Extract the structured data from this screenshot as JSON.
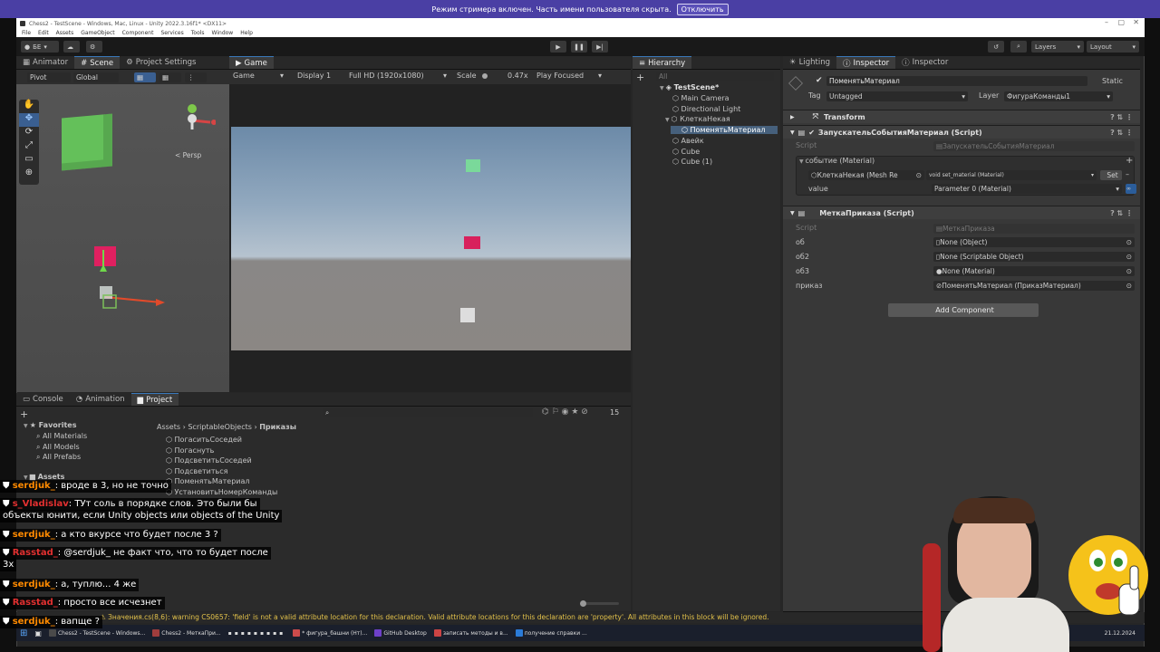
{
  "streamer_banner": {
    "text": "Режим стримера включен. Часть имени пользователя скрыта.",
    "button": "Отключить"
  },
  "window": {
    "title": "Chess2 - TestScene - Windows, Mac, Linux - Unity 2022.3.16f1* <DX11>"
  },
  "menu": [
    "File",
    "Edit",
    "Assets",
    "GameObject",
    "Component",
    "Services",
    "Tools",
    "Window",
    "Help"
  ],
  "toolbar": {
    "account": "БЕ",
    "layers": "Layers",
    "layout": "Layout"
  },
  "scene_panel": {
    "tabs": [
      "Animator",
      "Scene",
      "Project Settings"
    ],
    "pivot": "Pivot",
    "global": "Global",
    "persp": "< Persp"
  },
  "game_panel": {
    "tab": "Game",
    "mode": "Game",
    "display": "Display 1",
    "resolution": "Full HD (1920x1080)",
    "scale_label": "Scale",
    "scale_value": "0.47x",
    "play_focused": "Play Focused"
  },
  "hierarchy": {
    "tab": "Hierarchy",
    "search": "All",
    "items": [
      {
        "label": "TestScene*",
        "indent": 0,
        "type": "scene"
      },
      {
        "label": "Main Camera",
        "indent": 1,
        "type": "object"
      },
      {
        "label": "Directional Light",
        "indent": 1,
        "type": "object"
      },
      {
        "label": "КлеткаНекая",
        "indent": 1,
        "type": "object"
      },
      {
        "label": "ПоменятьМатериал",
        "indent": 2,
        "type": "object",
        "selected": true
      },
      {
        "label": "Авейк",
        "indent": 1,
        "type": "object"
      },
      {
        "label": "Cube",
        "indent": 1,
        "type": "object"
      },
      {
        "label": "Cube (1)",
        "indent": 1,
        "type": "object"
      }
    ]
  },
  "inspector": {
    "tabs": [
      "Lighting",
      "Inspector",
      "Inspector"
    ],
    "object_name": "ПоменятьМатериал",
    "static_label": "Static",
    "tag_label": "Tag",
    "tag_value": "Untagged",
    "layer_label": "Layer",
    "layer_value": "ФигураКоманды1",
    "transform": "Transform",
    "component1": {
      "title": "ЗапускательСобытияМатериал (Script)",
      "script_label": "Script",
      "script_value": "ЗапускательСобытияМатериал",
      "event_label": "событие (Material)",
      "event_object": "КлеткаНекая (Mesh Re",
      "event_method": "void set_material (Material)",
      "set_button": "Set",
      "value_label": "value",
      "value_value": "Parameter 0 (Material)"
    },
    "component2": {
      "title": "МеткаПриказа (Script)",
      "script_label": "Script",
      "script_value": "МеткаПриказа",
      "fields": [
        {
          "label": "об",
          "value": "None (Object)"
        },
        {
          "label": "об2",
          "value": "None (Scriptable Object)"
        },
        {
          "label": "об3",
          "value": "None (Material)"
        },
        {
          "label": "приказ",
          "value": "ПоменятьМатериал (ПриказМатериал)"
        }
      ]
    },
    "add_component": "Add Component"
  },
  "project_panel": {
    "tabs": [
      "Console",
      "Animation",
      "Project"
    ],
    "favorites": "Favorites",
    "favorite_items": [
      "All Materials",
      "All Models",
      "All Prefabs"
    ],
    "assets_label": "Assets",
    "breadcrumb": [
      "Assets",
      "ScriptableObjects",
      "Приказы"
    ],
    "files": [
      "ПогаситьСоседей",
      "Погаснуть",
      "ПодсветитьСоседей",
      "Подсветиться",
      "ПоменятьМатериал",
      "УстановитьНомерКоманды"
    ],
    "count": "15"
  },
  "console_message": "Значения.cs(8,6): warning CS0657: 'field' is not a valid attribute location for this declaration. Valid attribute locations for this declaration are 'property'. All attributes in this block will be ignored.",
  "chat": [
    {
      "user": "serdjuk_",
      "color": "orange",
      "text": "вроде в 3, но не точно"
    },
    {
      "user": "s_Vladislav",
      "color": "red",
      "text": "ТУт соль в порядке слов. Это были бы",
      "text2": "объекты юнити, если Unity objects или objects of the Unity"
    },
    {
      "user": "serdjuk_",
      "color": "orange",
      "text": "а кто вкурсе что будет после 3 ?"
    },
    {
      "user": "Rasstad_",
      "color": "red",
      "text": "@serdjuk_ не факт что, что то будет после",
      "text2": "3х"
    },
    {
      "user": "serdjuk_",
      "color": "orange",
      "text": "а, туплю... 4 же"
    },
    {
      "user": "Rasstad_",
      "color": "red",
      "text": "просто все исчезнет"
    },
    {
      "user": "serdjuk_",
      "color": "orange",
      "text": "вапще ?"
    }
  ],
  "taskbar": [
    {
      "label": "Chess2 - TestScene - Windows...",
      "color": "#4a4a4a"
    },
    {
      "label": "Chess2 - МеткаПри...",
      "color": "#a03d3d"
    },
    {
      "label": "* фигура_башни (Нт)...",
      "color": "#cc4b4b"
    },
    {
      "label": "GitHub Desktop",
      "color": "#6e40c9"
    },
    {
      "label": "записать методы и в...",
      "color": "#c44"
    },
    {
      "label": "получение справки ...",
      "color": "#2b7bd8"
    }
  ],
  "clock": "21.12.2024"
}
